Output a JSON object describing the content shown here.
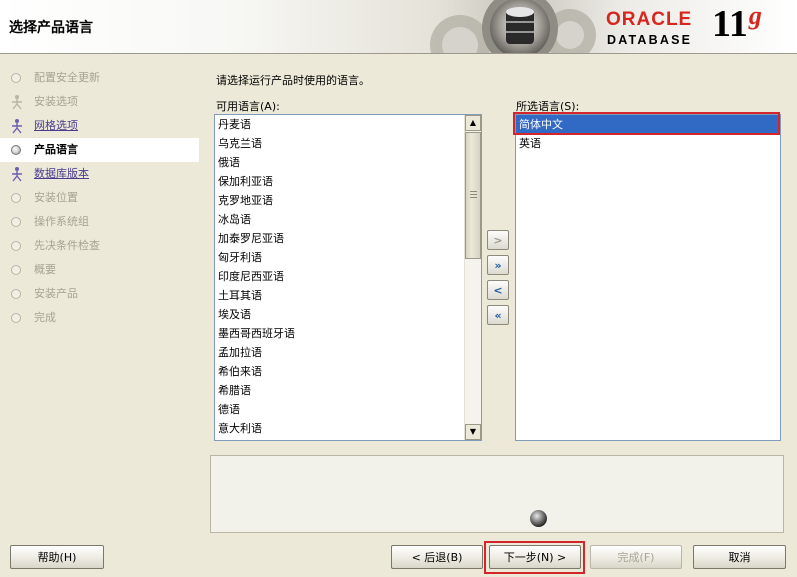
{
  "window": {
    "title": "选择产品语言",
    "brand": "ORACLE",
    "product": "DATABASE",
    "version_main": "11",
    "version_suffix": "g"
  },
  "steps": [
    {
      "label": "配置安全更新",
      "state": "pending"
    },
    {
      "label": "安装选项",
      "state": "pending"
    },
    {
      "label": "网格选项",
      "state": "done"
    },
    {
      "label": "产品语言",
      "state": "current"
    },
    {
      "label": "数据库版本",
      "state": "done"
    },
    {
      "label": "安装位置",
      "state": "pending"
    },
    {
      "label": "操作系统组",
      "state": "pending"
    },
    {
      "label": "先决条件检查",
      "state": "pending"
    },
    {
      "label": "概要",
      "state": "pending"
    },
    {
      "label": "安装产品",
      "state": "pending"
    },
    {
      "label": "完成",
      "state": "pending"
    }
  ],
  "main": {
    "instruction": "请选择运行产品时使用的语言。",
    "available_label": "可用语言(A):",
    "selected_label": "所选语言(S):",
    "available_languages": [
      "丹麦语",
      "乌克兰语",
      "俄语",
      "保加利亚语",
      "克罗地亚语",
      "冰岛语",
      "加泰罗尼亚语",
      "匈牙利语",
      "印度尼西亚语",
      "土耳其语",
      "埃及语",
      "墨西哥西班牙语",
      "孟加拉语",
      "希伯来语",
      "希腊语",
      "德语",
      "意大利语"
    ],
    "selected_languages": [
      "简体中文",
      "英语"
    ],
    "selected_index": 0
  },
  "move_buttons": {
    "add": ">",
    "add_all": "»",
    "remove": "<",
    "remove_all": "«"
  },
  "buttons": {
    "help": "帮助(H)",
    "back": "< 后退(B)",
    "next": "下一步(N) >",
    "finish": "完成(F)",
    "cancel": "取消"
  },
  "colors": {
    "accent_red": "#d7261e",
    "selection_blue": "#316ac5",
    "highlight_red": "#d4252c"
  }
}
